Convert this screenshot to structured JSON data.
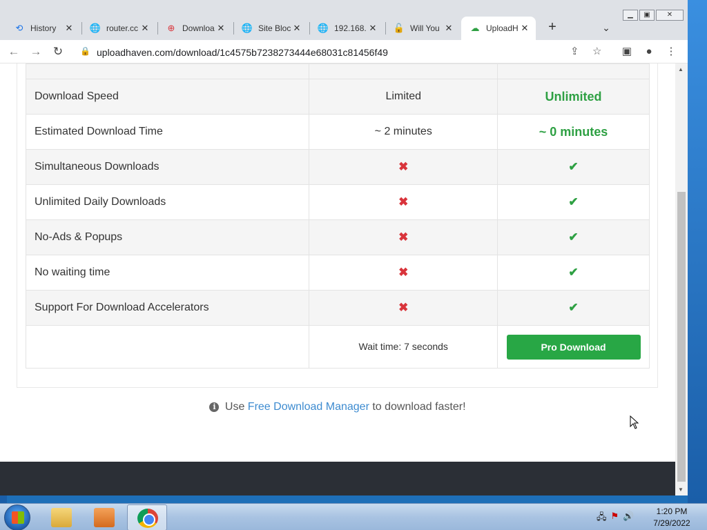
{
  "browser": {
    "tabs": [
      {
        "title": "History",
        "icon": "history-icon",
        "active": false
      },
      {
        "title": "router.cc",
        "icon": "globe-icon",
        "active": false
      },
      {
        "title": "Downloa",
        "icon": "lifebuoy-icon",
        "active": false
      },
      {
        "title": "Site Bloc",
        "icon": "globe-icon",
        "active": false
      },
      {
        "title": "192.168.",
        "icon": "globe-icon",
        "active": false
      },
      {
        "title": "Will You",
        "icon": "lock-red-icon",
        "active": false
      },
      {
        "title": "UploadH",
        "icon": "uploadhaven-icon",
        "active": true
      }
    ],
    "url": "uploadhaven.com/download/1c4575b7238273444e68031c81456f49"
  },
  "comparison": {
    "rows": [
      {
        "feature": "Download Speed",
        "free": "Limited",
        "pro": "Unlimited",
        "type": "text"
      },
      {
        "feature": "Estimated Download Time",
        "free": "~ 2 minutes",
        "pro": "~ 0 minutes",
        "type": "text"
      },
      {
        "feature": "Simultaneous Downloads",
        "free": "✖",
        "pro": "✔",
        "type": "icon"
      },
      {
        "feature": "Unlimited Daily Downloads",
        "free": "✖",
        "pro": "✔",
        "type": "icon"
      },
      {
        "feature": "No-Ads & Popups",
        "free": "✖",
        "pro": "✔",
        "type": "icon"
      },
      {
        "feature": "No waiting time",
        "free": "✖",
        "pro": "✔",
        "type": "icon"
      },
      {
        "feature": "Support For Download Accelerators",
        "free": "✖",
        "pro": "✔",
        "type": "icon"
      }
    ],
    "wait_time": "Wait time: 7 seconds",
    "pro_button": "Pro Download"
  },
  "fdm_notice": {
    "prefix": "Use",
    "link": "Free Download Manager",
    "suffix": "to download faster!"
  },
  "taskbar": {
    "time": "1:20 PM",
    "date": "7/29/2022"
  },
  "colors": {
    "green": "#28a745",
    "red": "#d9343b",
    "link": "#3d8bd0"
  }
}
